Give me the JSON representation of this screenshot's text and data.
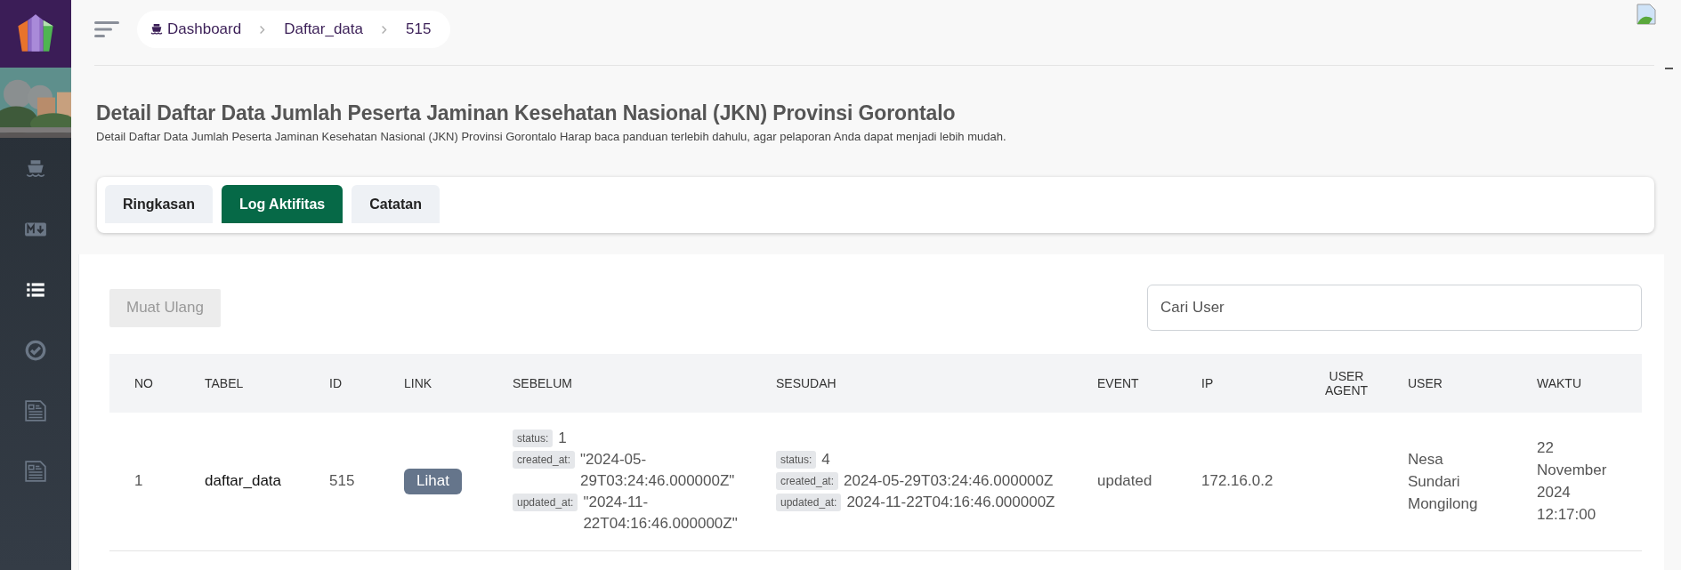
{
  "sidebar": {
    "items": [
      {
        "kind": "ship",
        "selected": false
      },
      {
        "kind": "markdown",
        "selected": false
      },
      {
        "kind": "list",
        "selected": true
      },
      {
        "kind": "check",
        "selected": false
      },
      {
        "kind": "document",
        "selected": false
      },
      {
        "kind": "document",
        "selected": false
      }
    ]
  },
  "breadcrumb": [
    {
      "label": "Dashboard"
    },
    {
      "label": "Daftar_data"
    },
    {
      "label": "515"
    }
  ],
  "page": {
    "title": "Detail Daftar Data Jumlah Peserta Jaminan Kesehatan Nasional (JKN) Provinsi Gorontalo",
    "subtitle": "Detail Daftar Data Jumlah Peserta Jaminan Kesehatan Nasional (JKN) Provinsi Gorontalo Harap baca panduan terlebih dahulu, agar pelaporan Anda dapat menjadi lebih mudah."
  },
  "tabs": [
    {
      "label": "Ringkasan",
      "selected": false
    },
    {
      "label": "Log Aktifitas",
      "selected": true
    },
    {
      "label": "Catatan",
      "selected": false
    }
  ],
  "toolbar": {
    "reload_button": {
      "label": "Muat Ulang",
      "disabled": true
    },
    "search": {
      "placeholder": "Cari User"
    }
  },
  "table": {
    "columns": [
      "NO",
      "TABEL",
      "ID",
      "LINK",
      "SEBELUM",
      "SESUDAH",
      "EVENT",
      "IP",
      "USER AGENT",
      "USER",
      "WAKTU"
    ],
    "rows": [
      {
        "no": "1",
        "tabel": "daftar_data",
        "id": "515",
        "link": "Lihat",
        "sebelum": [
          {
            "key": "status:",
            "value": "1"
          },
          {
            "key": "created_at:",
            "value": "\"2024-05-29T03:24:46.000000Z\""
          },
          {
            "key": "updated_at:",
            "value": "\"2024-11-22T04:16:46.000000Z\""
          }
        ],
        "sesudah": [
          {
            "key": "status:",
            "value": "4"
          },
          {
            "key": "created_at:",
            "value": "2024-05-29T03:24:46.000000Z"
          },
          {
            "key": "updated_at:",
            "value": "2024-11-22T04:16:46.000000Z"
          }
        ],
        "event": "updated",
        "ip": "172.16.0.2",
        "user": "Nesa Sundari Mongilong",
        "waktu": "22 November 2024 12:17:00"
      }
    ]
  }
}
